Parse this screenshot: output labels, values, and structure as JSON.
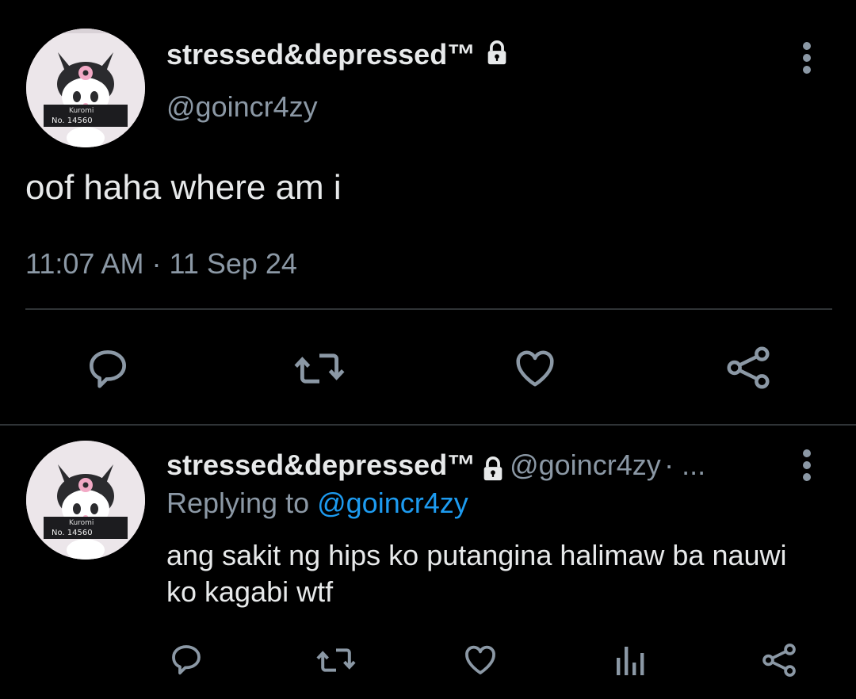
{
  "tweet": {
    "display_name": "stressed&depressed™",
    "handle": "@goincr4zy",
    "text": "oof haha where am i",
    "time": "11:07 AM",
    "separator": "·",
    "date": "11 Sep 24",
    "avatar": {
      "label_top": "Kuromi",
      "label_bottom": "No. 14560"
    }
  },
  "reply": {
    "display_name": "stressed&depressed™",
    "handle": "@goincr4zy",
    "suffix": "· ...",
    "replying_prefix": "Replying to ",
    "replying_handle": "@goincr4zy",
    "text": "ang sakit ng hips ko putangina halimaw ba nauwi ko kagabi wtf",
    "avatar": {
      "label_top": "Kuromi",
      "label_bottom": "No. 14560"
    }
  },
  "colors": {
    "background": "#000000",
    "text": "#e7e9ea",
    "muted": "#8b98a5",
    "link": "#1d9bf0",
    "divider": "#2f3336"
  },
  "icons": [
    "lock-icon",
    "more-icon",
    "reply-icon",
    "retweet-icon",
    "like-icon",
    "share-icon",
    "analytics-icon"
  ]
}
